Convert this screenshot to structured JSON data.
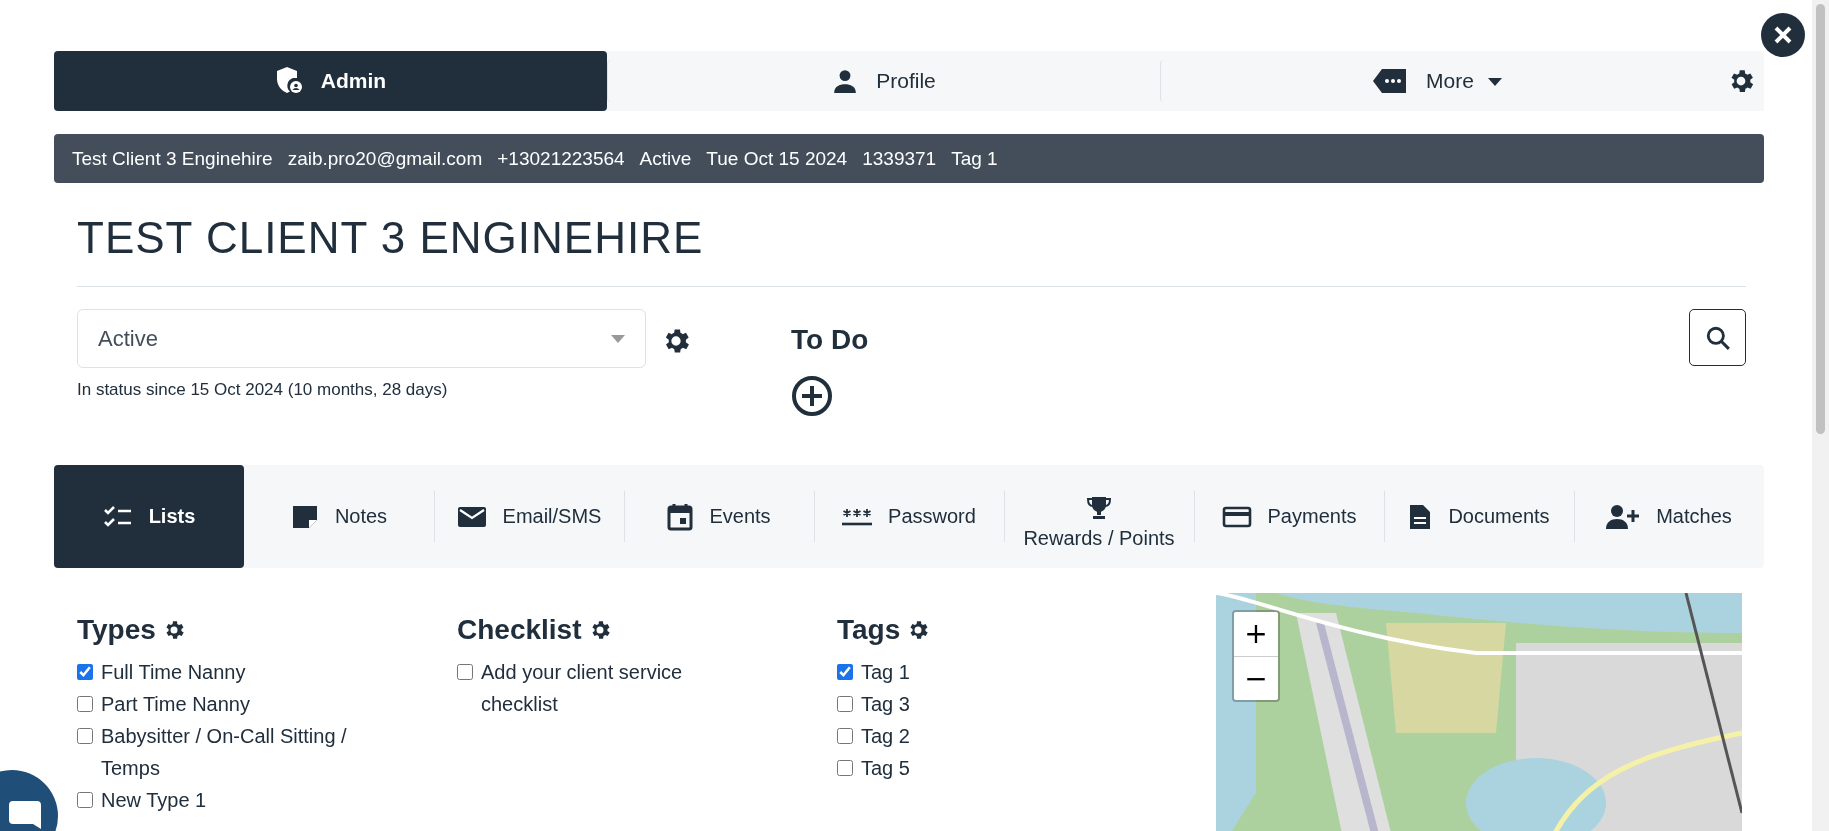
{
  "nav": {
    "tabs": [
      {
        "label": "Admin",
        "kind": "link",
        "selected": true
      },
      {
        "label": "Profile",
        "kind": "link",
        "selected": false
      },
      {
        "label": "More",
        "kind": "menu",
        "selected": false
      }
    ]
  },
  "info_bar": {
    "items": [
      "Test Client 3 Enginehire",
      "zaib.pro20@gmail.com",
      "+13021223564",
      "Active",
      "Tue Oct 15 2024",
      "1339371",
      "Tag 1"
    ]
  },
  "title": "TEST CLIENT 3 ENGINEHIRE",
  "status": {
    "value": "Active",
    "note": "In status since 15 Oct 2024 (10 months, 28 days)"
  },
  "todo": {
    "heading": "To Do"
  },
  "tabs": [
    {
      "label": "Lists",
      "kind": "inline",
      "selected": true
    },
    {
      "label": "Notes",
      "kind": "inline",
      "selected": false
    },
    {
      "label": "Email/SMS",
      "kind": "inline",
      "selected": false
    },
    {
      "label": "Events",
      "kind": "inline",
      "selected": false
    },
    {
      "label": "Password",
      "kind": "inline",
      "selected": false
    },
    {
      "label": "Rewards / Points",
      "kind": "stacked",
      "selected": false
    },
    {
      "label": "Payments",
      "kind": "inline",
      "selected": false
    },
    {
      "label": "Documents",
      "kind": "inline",
      "selected": false
    },
    {
      "label": "Matches",
      "kind": "inline",
      "selected": false
    }
  ],
  "sections": [
    {
      "title": "Types",
      "items": [
        {
          "label": "Full Time Nanny",
          "checked": true
        },
        {
          "label": "Part Time Nanny",
          "checked": false
        },
        {
          "label": "Babysitter / On-Call Sitting / Temps",
          "checked": false
        },
        {
          "label": "New Type 1",
          "checked": false
        }
      ]
    },
    {
      "title": "Checklist",
      "items": [
        {
          "label": "Add your client service checklist",
          "checked": false
        }
      ]
    },
    {
      "title": "Tags",
      "items": [
        {
          "label": "Tag 1",
          "checked": true
        },
        {
          "label": "Tag 3",
          "checked": false
        },
        {
          "label": "Tag 2",
          "checked": false
        },
        {
          "label": "Tag 5",
          "checked": false
        }
      ]
    }
  ],
  "map": {
    "zoom_in": "+",
    "zoom_out": "−"
  }
}
